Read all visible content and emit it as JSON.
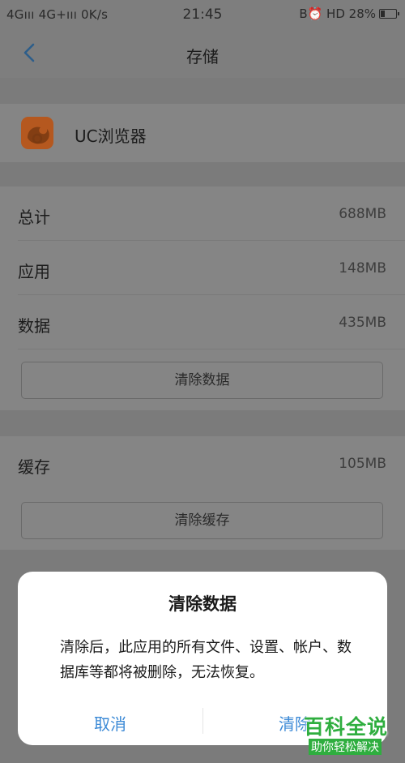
{
  "status_bar": {
    "left": "4Gııı 4G+ııı 0K/s",
    "time": "21:45",
    "right": "B⏰ HD 28%",
    "battery_level": 0.28
  },
  "nav": {
    "title": "存储",
    "back_icon": "chevron-left-icon"
  },
  "app": {
    "name": "UC浏览器",
    "icon": "uc-browser-icon",
    "icon_color": "#e8762c"
  },
  "storage": {
    "rows": [
      {
        "label": "总计",
        "value": "688MB"
      },
      {
        "label": "应用",
        "value": "148MB"
      },
      {
        "label": "数据",
        "value": "435MB"
      }
    ],
    "clear_data_label": "清除数据"
  },
  "cache": {
    "label": "缓存",
    "value": "105MB",
    "clear_cache_label": "清除缓存"
  },
  "dialog": {
    "title": "清除数据",
    "message": "清除后，此应用的所有文件、设置、帐户、数据库等都将被删除，无法恢复。",
    "cancel_label": "取消",
    "confirm_label": "清除",
    "button_color": "#3c8ad6"
  },
  "watermark": {
    "title": "百科全说",
    "subtitle": "助你轻松解决"
  }
}
